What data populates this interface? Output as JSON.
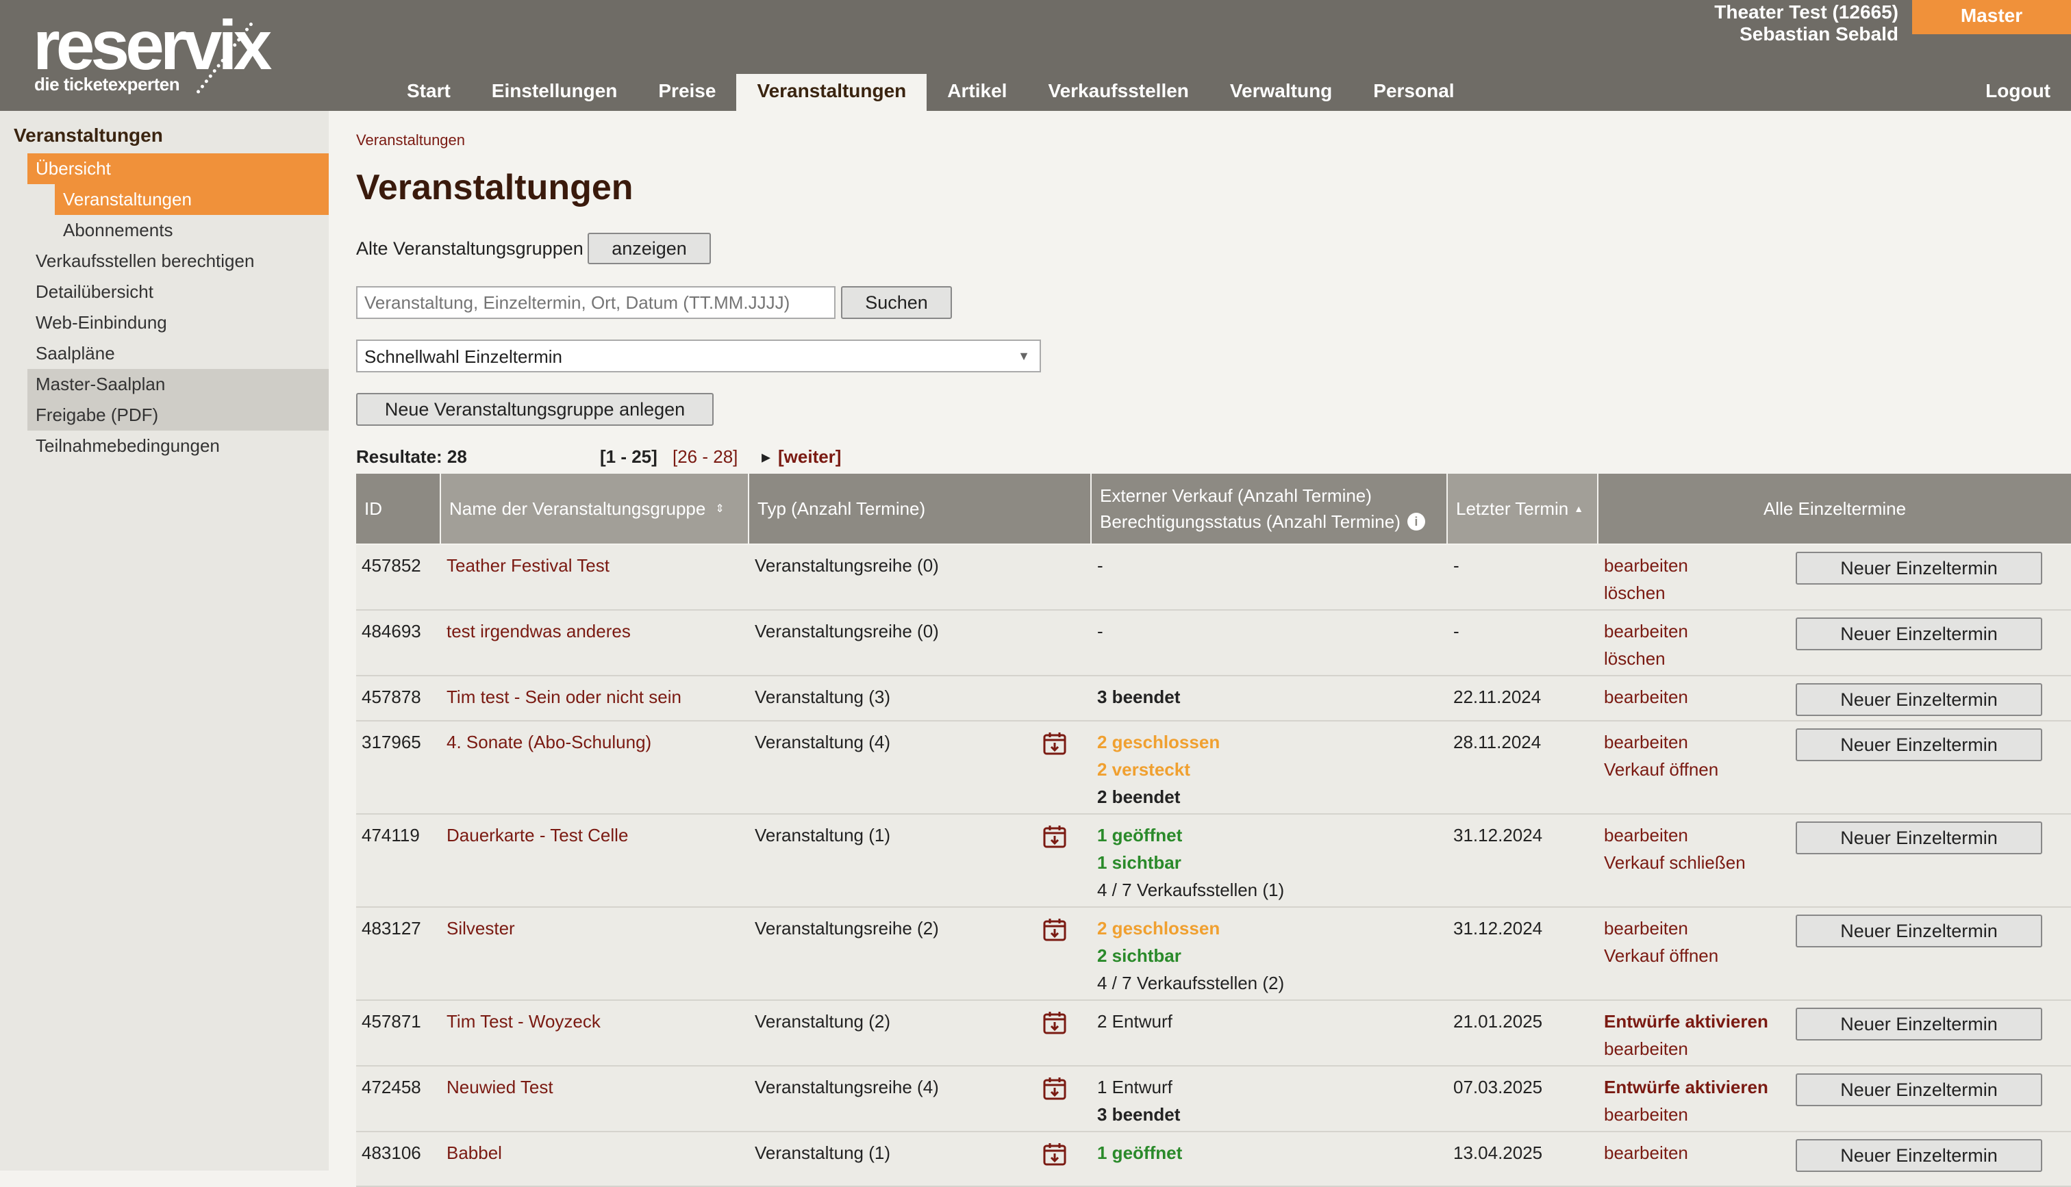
{
  "brand": {
    "logo_text": "reservix",
    "tagline": "die ticketexperten"
  },
  "header": {
    "user_line1": "Theater Test (12665)",
    "user_line2": "Sebastian Sebald",
    "master_label": "Master",
    "logout_label": "Logout",
    "tabs": [
      {
        "label": "Start"
      },
      {
        "label": "Einstellungen"
      },
      {
        "label": "Preise"
      },
      {
        "label": "Veranstaltungen"
      },
      {
        "label": "Artikel"
      },
      {
        "label": "Verkaufsstellen"
      },
      {
        "label": "Verwaltung"
      },
      {
        "label": "Personal"
      }
    ]
  },
  "sidebar": {
    "title": "Veranstaltungen",
    "items": [
      {
        "label": "Übersicht"
      },
      {
        "label": "Veranstaltungen"
      },
      {
        "label": "Abonnements"
      },
      {
        "label": "Verkaufsstellen berechtigen"
      },
      {
        "label": "Detailübersicht"
      },
      {
        "label": "Web-Einbindung"
      },
      {
        "label": "Saalpläne"
      },
      {
        "label": "Master-Saalplan"
      },
      {
        "label": "Freigabe (PDF)"
      },
      {
        "label": "Teilnahmebedingungen"
      }
    ]
  },
  "main": {
    "breadcrumb": "Veranstaltungen",
    "title": "Veranstaltungen",
    "old_groups_label": "Alte Veranstaltungsgruppen",
    "show_button": "anzeigen",
    "search_placeholder": "Veranstaltung, Einzeltermin, Ort, Datum (TT.MM.JJJJ)",
    "search_button": "Suchen",
    "quick_select": "Schnellwahl Einzeltermin",
    "new_group_button": "Neue Veranstaltungsgruppe anlegen",
    "results_label": "Resultate: 28",
    "pager_current": "[1 - 25]",
    "pager_next": "[26 - 28]",
    "pager_weiter": "[weiter]"
  },
  "table": {
    "headers": {
      "id": "ID",
      "name": "Name der Veranstaltungsgruppe",
      "type": "Typ (Anzahl Termine)",
      "ext1": "Externer Verkauf (Anzahl Termine)",
      "ext2": "Berechtigungsstatus (Anzahl Termine)",
      "last": "Letzter Termin",
      "all": "Alle Einzeltermine"
    },
    "new_termin_label": "Neuer Einzeltermin",
    "rows": [
      {
        "id": "457852",
        "name": "Teather Festival Test",
        "type": "Veranstaltungsreihe (0)",
        "status": [
          "-"
        ],
        "last": "-",
        "actions": [
          "bearbeiten",
          "löschen"
        ]
      },
      {
        "id": "484693",
        "name": "test irgendwas anderes",
        "type": "Veranstaltungsreihe (0)",
        "status": [
          "-"
        ],
        "last": "-",
        "actions": [
          "bearbeiten",
          "löschen"
        ]
      },
      {
        "id": "457878",
        "name": "Tim test - Sein oder nicht sein",
        "type": "Veranstaltung (3)",
        "status": [
          "3 beendet"
        ],
        "last": "22.11.2024",
        "actions": [
          "bearbeiten"
        ]
      },
      {
        "id": "317965",
        "name": "4. Sonate (Abo-Schulung)",
        "type": "Veranstaltung (4)",
        "status": [
          "2 geschlossen",
          "2 versteckt",
          "2 beendet"
        ],
        "last": "28.11.2024",
        "actions": [
          "bearbeiten",
          "Verkauf öffnen"
        ]
      },
      {
        "id": "474119",
        "name": "Dauerkarte - Test Celle",
        "type": "Veranstaltung (1)",
        "status": [
          "1 geöffnet",
          "1 sichtbar",
          "4 / 7 Verkaufsstellen (1)"
        ],
        "last": "31.12.2024",
        "actions": [
          "bearbeiten",
          "Verkauf schließen"
        ]
      },
      {
        "id": "483127",
        "name": "Silvester",
        "type": "Veranstaltungsreihe (2)",
        "status": [
          "2 geschlossen",
          "2 sichtbar",
          "4 / 7 Verkaufsstellen (2)"
        ],
        "last": "31.12.2024",
        "actions": [
          "bearbeiten",
          "Verkauf öffnen"
        ]
      },
      {
        "id": "457871",
        "name": "Tim Test - Woyzeck",
        "type": "Veranstaltung (2)",
        "status": [
          "2 Entwurf"
        ],
        "last": "21.01.2025",
        "actions": [
          "Entwürfe aktivieren",
          "bearbeiten"
        ]
      },
      {
        "id": "472458",
        "name": "Neuwied Test",
        "type": "Veranstaltungsreihe (4)",
        "status": [
          "1 Entwurf",
          "3 beendet"
        ],
        "last": "07.03.2025",
        "actions": [
          "Entwürfe aktivieren",
          "bearbeiten"
        ]
      },
      {
        "id": "483106",
        "name": "Babbel",
        "type": "Veranstaltung (1)",
        "status": [
          "1 geöffnet"
        ],
        "last": "13.04.2025",
        "actions": [
          "bearbeiten"
        ]
      }
    ]
  },
  "colors": {
    "header": "#6f6c66",
    "accent": "#f0913a",
    "link": "#7a1a12",
    "green": "#2a8a2a",
    "orange": "#f0a030"
  }
}
